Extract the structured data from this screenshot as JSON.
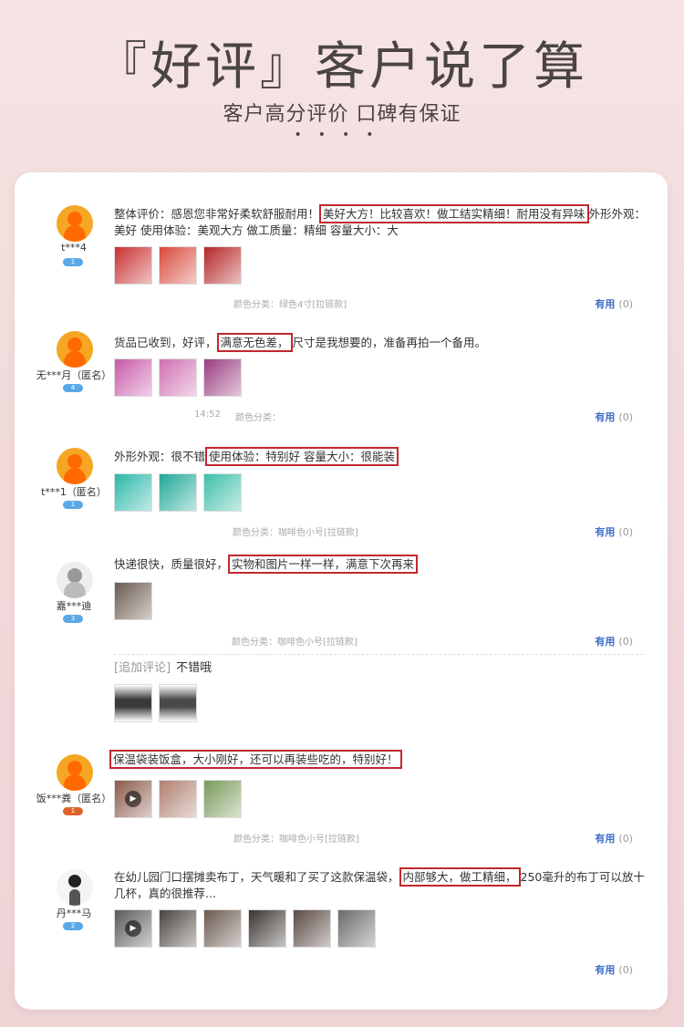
{
  "header": {
    "title": "『好评』客户说了算",
    "subtitle": "客户高分评价 口碑有保证",
    "dots": "••••"
  },
  "reviews": [
    {
      "username": "t***4",
      "badge": "1",
      "text_before": "整体评价：感恩您非常好柔软舒服耐用！",
      "text_highlight": "美好大方！比较喜欢！做工结实精细！耐用没有异味",
      "text_after": "外形外观：美好 使用体验：美观大方 做工质量：精细 容量大小：大",
      "category": "颜色分类：绿色4寸[拉链款]",
      "useful": "有用",
      "useful_count": "(0)",
      "thumb_colors": [
        "#c8302f",
        "#d94a3a",
        "#b52525"
      ]
    },
    {
      "username": "无***月（匿名）",
      "badge": "4",
      "text_before": "货品已收到，好评，",
      "text_highlight": "满意无色差，",
      "text_after": "尺寸是我想要的，准备再拍一个备用。",
      "time": "14:52",
      "category": "颜色分类：",
      "useful": "有用",
      "useful_count": "(0)",
      "thumb_colors": [
        "#c85aa8",
        "#d070b0",
        "#9a3d80"
      ]
    },
    {
      "username": "t***1（匿名）",
      "badge": "1",
      "text_before": "外形外观：很不错",
      "text_highlight": "使用体验：特别好 容量大小：很能装",
      "text_after": "",
      "category": "颜色分类：咖啡色小号[拉链款]",
      "useful": "有用",
      "useful_count": "(0)",
      "thumb_colors": [
        "#2ab8a8",
        "#20a898",
        "#3cc0a8"
      ]
    },
    {
      "username": "嘉***迪",
      "badge": "3",
      "text_before": "快递很快，质量很好，",
      "text_highlight": "实物和图片一样一样，满意下次再来",
      "text_after": "",
      "category": "颜色分类：咖啡色小号[拉链款]",
      "useful": "有用",
      "useful_count": "(0)",
      "append_label": "[追加评论]",
      "append_text": "不错哦",
      "thumb_colors": [
        "#6a5a50"
      ],
      "append_thumb_colors": [
        "#3a3a3a",
        "#4a4a4a"
      ]
    },
    {
      "username": "饭***粪（匿名）",
      "badge": "1",
      "text_before": "",
      "text_highlight": "保温袋装饭盒，大小刚好，还可以再装些吃的，特别好！",
      "text_after": "",
      "category": "颜色分类：咖啡色小号[拉链款]",
      "useful": "有用",
      "useful_count": "(0)",
      "thumb_colors": [
        "#8a5a4a",
        "#b08070",
        "#7a9a5a"
      ]
    },
    {
      "username": "丹***马",
      "badge": "2",
      "text_before": "在幼儿园门口摆摊卖布丁，天气暖和了买了这款保温袋，",
      "text_highlight": "内部够大，做工精细，",
      "text_after": "250毫升的布丁可以放十几杯，真的很推荐...",
      "useful": "有用",
      "useful_count": "(0)",
      "thumb_colors": [
        "#5a5a5a",
        "#4a4440",
        "#6a5a50",
        "#3a3430",
        "#5a4a44",
        "#6a6a6a"
      ]
    }
  ]
}
